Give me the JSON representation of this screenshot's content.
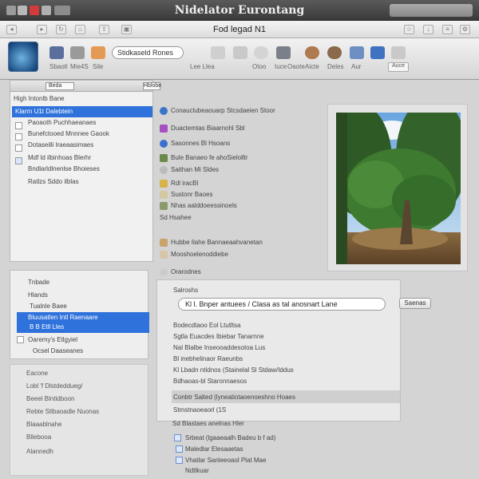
{
  "window": {
    "title": "Nidelator Eurontang"
  },
  "pathbar": {
    "label": "Fod legad N1"
  },
  "toolbar": {
    "search_value": "Stidkaseld Rones",
    "labels": [
      "Sbaotl",
      "Mie4S",
      "Sile",
      "Lee  Llea",
      "Otoo",
      "Iuce",
      "Oaote",
      "Aicte",
      "Deles",
      "Aur"
    ],
    "button": "Auce"
  },
  "left_list": {
    "header_field": "Beda",
    "header_field2": "Hblobe",
    "items": [
      "High Intonlb Bane",
      "Klarrn U1t Dalebtein",
      "Paoaoth Puchhaeanaes",
      "Bunefctooed Mnnnee Gaook",
      "Dotaseilli lraeaasimaes",
      "Mdf ld ilbinhoas Blerhr",
      "Bndlarldlnenlse Bhoieses",
      "Ratlzs Sddo ilblas"
    ],
    "selected_index": 1
  },
  "middle_list": {
    "header": "Conauclubeaouarp Stcsdaeien Stoor",
    "items": [
      "Duactemtas Biaarnohl Sbl",
      "Sasonnes Bl Hsoans",
      "Bule Banaeo fe ahoSielolltr",
      "Saithan Mi Sldes",
      "Rdl iracBl",
      "Sustonr Baoes",
      "Nhas aalddoeessinoels",
      "Sd Hsahee",
      "Hubbe Ilahe Bannaeaahvanetan",
      "Mooshoelenoddiebe",
      "Orarodnes"
    ]
  },
  "left_mid": {
    "items": [
      "Tnbade",
      "Hlands",
      "Tualnle Baee",
      "Bluusatlen Intl Raenaare",
      "B B Etll Lles",
      "Oaremy's Etlgyiel",
      "Ocsel Daaseanes"
    ]
  },
  "left_bottom": {
    "header": "Eacone",
    "items": [
      "Lobl 'f Dlstdeddueg/",
      "Beeel Blntidboon",
      "Rebte Stlbaoadle Nuonas",
      "Blaaablnahe",
      "Bllebooa",
      "Alannedh"
    ]
  },
  "panel": {
    "title": "Salroshs",
    "input_value": "Kl l. Bnper antuees / Clasa as tal anosnart Lane",
    "button": "Saenas",
    "rows": [
      "Bodecdtaoo Eol Ltutltsa",
      "Sgtla Euacdes Ibiebar Tanarnne",
      "Nal Blalbe Inseooaddesotoa Lus",
      "Bl inebhelinaor Raeunbs",
      "Kl Lbadn ntidnos (Stainelal Sl Stdaw/Iddus",
      "Bdhaoas-bl Staronnaesos",
      "Conbtr Salted (lyneatiotaoenoeshno Hoaes",
      "Stmstnaoeaorl (1S"
    ]
  },
  "bottom_mid": {
    "header": "Sd Blastaes anelnas Hler",
    "items": [
      "Srbeat (lgaaeaalh Badeu b f ad)",
      "Maledlar Elesaaetas",
      "Vhatlar Sanleeoaol Plat Mae",
      "Ndtlkuar"
    ]
  },
  "colors": {
    "accent": "#2f72dc",
    "titlebar": "#3f3f3f",
    "close": "#d23b3b"
  }
}
